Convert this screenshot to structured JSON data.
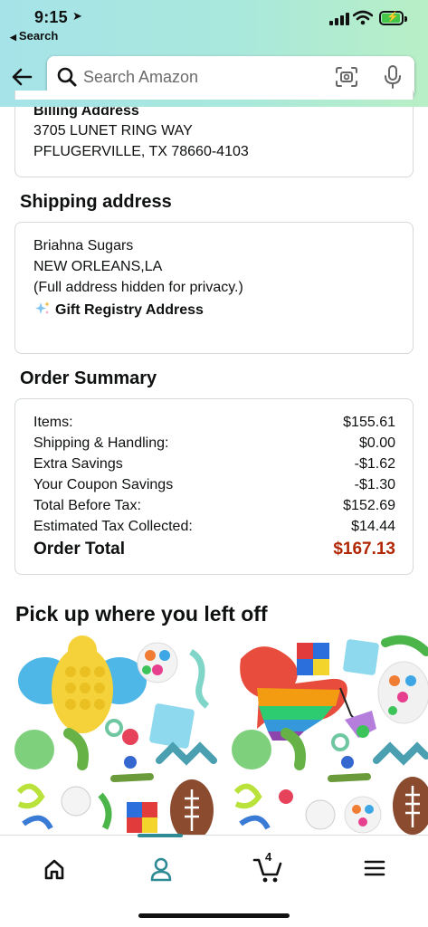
{
  "status_bar": {
    "time": "9:15",
    "back_app": "Search"
  },
  "search": {
    "placeholder": "Search Amazon"
  },
  "billing": {
    "heading": "Billing Address",
    "line1": "3705 LUNET RING WAY",
    "line2": "PFLUGERVILLE, TX 78660-4103"
  },
  "shipping": {
    "title": "Shipping address",
    "name": "Briahna Sugars",
    "city": "NEW ORLEANS,LA",
    "note": "(Full address hidden for privacy.)",
    "gift_registry": "Gift Registry Address"
  },
  "order_summary": {
    "title": "Order Summary",
    "rows": [
      {
        "label": "Items:",
        "value": "$155.61"
      },
      {
        "label": "Shipping & Handling:",
        "value": "$0.00"
      },
      {
        "label": "Extra Savings",
        "value": "-$1.62"
      },
      {
        "label": "Your Coupon Savings",
        "value": "-$1.30"
      },
      {
        "label": "Total Before Tax:",
        "value": "$152.69"
      },
      {
        "label": "Estimated Tax Collected:",
        "value": "$14.44"
      }
    ],
    "total": {
      "label": "Order Total",
      "value": "$167.13"
    },
    "total_color": "#B12704"
  },
  "pickup": {
    "title": "Pick up where you left off"
  },
  "tab_bar": {
    "cart_count": "4",
    "active_tab": "account",
    "accent_color": "#2E8A95",
    "icons": [
      "home-icon",
      "account-icon",
      "cart-icon",
      "menu-icon"
    ]
  }
}
